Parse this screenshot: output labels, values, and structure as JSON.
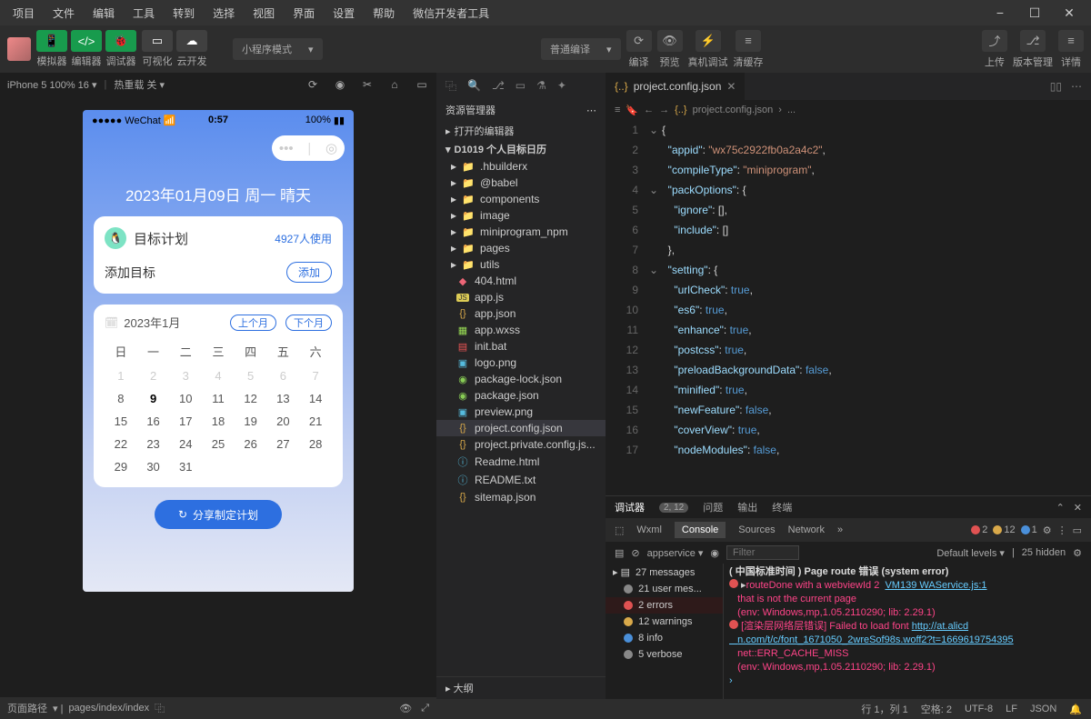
{
  "menu": [
    "项目",
    "文件",
    "编辑",
    "工具",
    "转到",
    "选择",
    "视图",
    "界面",
    "设置",
    "帮助",
    "微信开发者工具"
  ],
  "toolbar": {
    "group1_labels": [
      "模拟器",
      "编辑器",
      "调试器"
    ],
    "group2_labels": [
      "可视化",
      "云开发"
    ],
    "mode_select": "小程序模式",
    "compile_select": "普通编译",
    "compile_label": "编译",
    "preview_label": "预览",
    "remote_label": "真机调试",
    "clear_label": "清缓存",
    "upload_label": "上传",
    "version_label": "版本管理",
    "detail_label": "详情"
  },
  "simbar": {
    "device": "iPhone 5 100% 16",
    "hotreload": "热重载 关"
  },
  "phone": {
    "carrier": "WeChat",
    "time": "0:57",
    "battery": "100%",
    "date_text": "2023年01月09日 周一 晴天",
    "card_title": "目标计划",
    "card_users": "4927人使用",
    "add_text": "添加目标",
    "add_btn": "添加",
    "cal_ym": "2023年1月",
    "prev_month": "上个月",
    "next_month": "下个月",
    "weekdays": [
      "日",
      "一",
      "二",
      "三",
      "四",
      "五",
      "六"
    ],
    "share_btn": "分享制定计划"
  },
  "pathbar": {
    "label": "页面路径",
    "value": "pages/index/index"
  },
  "explorer": {
    "title": "资源管理器",
    "open_editors": "打开的编辑器",
    "project": "D1019 个人目标日历",
    "folders": [
      ".hbuilderx",
      "@babel",
      "components",
      "image",
      "miniprogram_npm",
      "pages",
      "utils"
    ],
    "files": [
      "404.html",
      "app.js",
      "app.json",
      "app.wxss",
      "init.bat",
      "logo.png",
      "package-lock.json",
      "package.json",
      "preview.png",
      "project.config.json",
      "project.private.config.js...",
      "Readme.html",
      "README.txt",
      "sitemap.json"
    ],
    "outline": "大纲"
  },
  "editor": {
    "tab_name": "project.config.json",
    "breadcrumb": "project.config.json",
    "code": {
      "l2_key": "appid",
      "l2_val": "wx75c2922fb0a2a4c2",
      "l3_key": "compileType",
      "l3_val": "miniprogram",
      "l4_key": "packOptions",
      "l5_key": "ignore",
      "l6_key": "include",
      "l8_key": "setting",
      "l9_key": "urlCheck",
      "l9_val": "true",
      "l10_key": "es6",
      "l10_val": "true",
      "l11_key": "enhance",
      "l11_val": "true",
      "l12_key": "postcss",
      "l12_val": "true",
      "l13_key": "preloadBackgroundData",
      "l13_val": "false",
      "l14_key": "minified",
      "l14_val": "true",
      "l15_key": "newFeature",
      "l15_val": "false",
      "l16_key": "coverView",
      "l16_val": "true",
      "l17_key": "nodeModules",
      "l17_val": "false"
    }
  },
  "debugger": {
    "tab": "调试器",
    "badge": "2, 12",
    "problems": "问题",
    "output": "输出",
    "terminal": "终端",
    "dev_tabs": [
      "Wxml",
      "Console",
      "Sources",
      "Network"
    ],
    "warn_count": "2",
    "err_count": "12",
    "info_count": "1",
    "filter_app": "appservice",
    "filter_placeholder": "Filter",
    "levels": "Default levels",
    "hidden": "25 hidden",
    "side": {
      "messages": "27 messages",
      "user": "21 user mes...",
      "errors": "2 errors",
      "warnings": "12 warnings",
      "info": "8 info",
      "verbose": "5 verbose"
    },
    "console": {
      "l0": "( 中国标准时间 ) Page route 错误 (system error)",
      "l1a": "routeDone with a webviewId 2",
      "l1b": "VM139 WAService.js:1",
      "l2": "that is not the current page",
      "l3": "(env: Windows,mp,1.05.2110290; lib: 2.29.1)",
      "l4a": "[渲染层网络层错误] Failed to load font ",
      "l4b": "http://at.alicd",
      "l5": "n.com/t/c/font_1671050_2wreSof98s.woff2?t=1669619754395",
      "l6": "net::ERR_CACHE_MISS",
      "l7": "(env: Windows,mp,1.05.2110290; lib: 2.29.1)"
    }
  },
  "statusbar": {
    "pos": "行 1，列 1",
    "spaces": "空格: 2",
    "encoding": "UTF-8",
    "eol": "LF",
    "lang": "JSON"
  }
}
